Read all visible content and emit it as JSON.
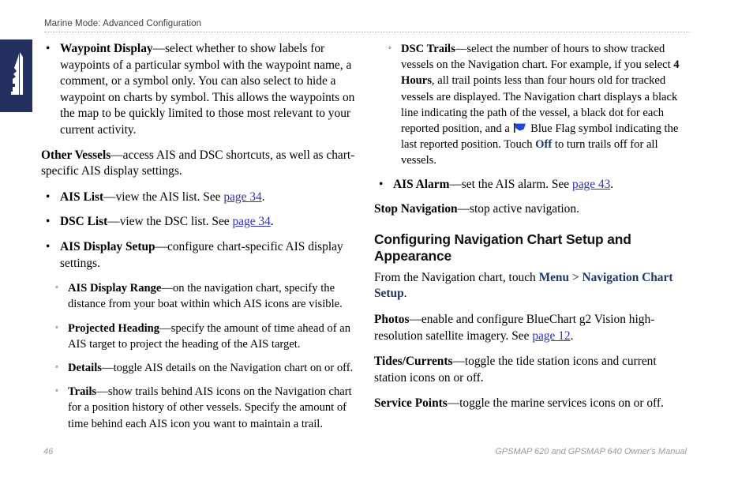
{
  "page": {
    "header_text": "Marine Mode: Advanced Configuration",
    "page_number": "46",
    "manual_title": "GPSMAP 620 and GPSMAP 640 Owner's Manual",
    "tab_color": "#243160",
    "link_color": "#2f2fbe",
    "emphasis_color": "#1f3668"
  },
  "side_tab": {
    "icon": "boat-icon"
  },
  "left_column": {
    "waypoint_display": {
      "bullet": "•",
      "term": "Waypoint Display",
      "body": "—select whether to show labels for waypoints of a particular symbol with the waypoint name, a comment, or a symbol only. You can also select to hide a waypoint on charts by symbol. This allows the waypoints on the map to be quickly limited to those most relevant to your current activity."
    },
    "other_vessels": {
      "term": "Other Vessels",
      "body": "—access AIS and DSC shortcuts, as well as chart-specific AIS display settings."
    },
    "ais_list": {
      "bullet": "•",
      "term": "AIS List",
      "body_before": "—view the AIS list. See ",
      "link": "page 34",
      "body_after": "."
    },
    "dsc_list": {
      "bullet": "•",
      "term": "DSC List",
      "body_before": "—view the DSC list. See ",
      "link": "page 34",
      "body_after": "."
    },
    "ais_display_setup": {
      "bullet": "•",
      "term": "AIS Display Setup",
      "body": "—configure chart-specific AIS display settings."
    },
    "sub_items": [
      {
        "bullet": "◦",
        "term": "AIS Display Range",
        "body": "—on the navigation chart, specify the distance from your boat within which AIS icons are visible."
      },
      {
        "bullet": "◦",
        "term": "Projected Heading",
        "body": "—specify the amount of time ahead of an AIS target to project the heading of the AIS target."
      },
      {
        "bullet": "◦",
        "term": "Details",
        "body": "—toggle AIS details on the Navigation chart on or off."
      },
      {
        "bullet": "◦",
        "term": "Trails",
        "body": "—show trails behind AIS icons on the Navigation chart for a position history of other vessels. Specify the amount of time behind each AIS icon you want to maintain a trail."
      }
    ]
  },
  "right_column": {
    "dsc_trails": {
      "bullet": "◦",
      "term": "DSC Trails",
      "part1": "—select the number of hours to show tracked vessels on the Navigation chart. For example, if you select ",
      "bold_value": "4 Hours",
      "part2": ", all trail points less than four hours old for tracked vessels are displayed. The Navigation chart displays a black line indicating the path of the vessel, a black dot for each reported position, and a ",
      "icon": "blue-flag-icon",
      "part3": " Blue Flag symbol indicating the last reported position. Touch ",
      "emphasis": "Off",
      "part4": " to turn trails off for all vessels."
    },
    "ais_alarm": {
      "bullet": "•",
      "term": "AIS Alarm",
      "body_before": "—set the AIS alarm. See ",
      "link": "page 43",
      "body_after": "."
    },
    "stop_navigation": {
      "term": "Stop Navigation",
      "body": "—stop active navigation."
    },
    "section_heading": "Configuring Navigation Chart Setup and Appearance",
    "intro": {
      "before": "From the Navigation chart, touch ",
      "menu": "Menu",
      "separator": " > ",
      "target": "Navigation Chart Setup",
      "after": "."
    },
    "photos": {
      "term": "Photos",
      "body_before": "—enable and configure BlueChart g2 Vision high-resolution satellite imagery. See ",
      "link": "page 12",
      "body_after": "."
    },
    "tides_currents": {
      "term": "Tides/Currents",
      "body": "—toggle the tide station icons and current station icons on or off."
    },
    "service_points": {
      "term": "Service Points",
      "body": "—toggle the marine services icons on or off."
    }
  }
}
